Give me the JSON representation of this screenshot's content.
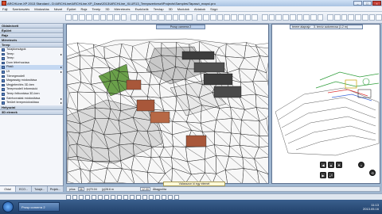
{
  "window": {
    "title": "ARCHLine.XP 2013 Standard - D:\\ARCHLine\\ARCHLine.XP_Draw\\2013\\ARCHLine_XLUR13_Terepszerkeszt\\Projects\\Samples\\Tapasz\\_maps\\.pro"
  },
  "menu": [
    "Fájl",
    "Szerkesztés",
    "Módosítás",
    "Nézet",
    "Épület",
    "Rajz",
    "Tereip",
    "3D",
    "Mérretezés",
    "Eszközök",
    "Tervlap",
    "3D",
    "Modulok",
    "Ablakok",
    "Súgó"
  ],
  "left_panel": {
    "sections": [
      {
        "label": "Oldalnézeti",
        "items": []
      },
      {
        "label": "Épület",
        "items": []
      },
      {
        "label": "Rajz",
        "items": []
      },
      {
        "label": "Méretezés",
        "items": []
      },
      {
        "label": "Terep",
        "items": [
          {
            "label": "Tulajdonságok",
            "arrow": false,
            "selected": false
          },
          {
            "label": "Terep",
            "arrow": true,
            "selected": false
          },
          {
            "label": "Terep",
            "arrow": false,
            "selected": false
          },
          {
            "label": "Dom létrehozása",
            "arrow": false,
            "selected": false
          },
          {
            "label": "Platö",
            "arrow": true,
            "selected": true
          },
          {
            "label": "Út",
            "arrow": true,
            "selected": false
          },
          {
            "label": "Tömegmodell",
            "arrow": false,
            "selected": false
          },
          {
            "label": "Magasság módosítása",
            "arrow": false,
            "selected": false
          },
          {
            "label": "Megjelenítés 3D-ben",
            "arrow": false,
            "selected": false
          },
          {
            "label": "Terepmodell információ",
            "arrow": false,
            "selected": false
          },
          {
            "label": "Terep felbontása 3D-ben",
            "arrow": false,
            "selected": false
          },
          {
            "label": "Szintvonalak módosítása",
            "arrow": true,
            "selected": false
          },
          {
            "label": "Terület terepmódosítása",
            "arrow": true,
            "selected": false
          }
        ]
      },
      {
        "label": "Helyszíni",
        "items": []
      },
      {
        "label": "3D elemek",
        "items": []
      }
    ],
    "tabs": [
      {
        "label": "Oldal",
        "active": true
      },
      {
        "label": "ECO...",
        "active": false
      },
      {
        "label": "Tulajd...",
        "active": false
      },
      {
        "label": "Projek...",
        "active": false
      }
    ]
  },
  "viewports": {
    "left_caption": "Prosp camerra 2",
    "right_caption": [
      "terere alaprajz",
      "3. tervíz autorrecsa (1.2 m)"
    ]
  },
  "nav_widget": {
    "buttons": [
      "◀",
      "▲",
      "▼",
      "▶",
      "⤢",
      "⌂",
      "⟲"
    ]
  },
  "status": {
    "hint": "Válasszon ki egy elemet",
    "field1_label": "pílus",
    "field1_value": "08",
    "field2_value": "(x)70.04",
    "field3_value": "(y)28.6 m",
    "field4_value": "12.00",
    "field5_label": "Átlagpolíta"
  },
  "taskbar": {
    "app_label": "Prosp comerra 2",
    "time": "11:13",
    "date": "2013.05.16"
  },
  "colors": {
    "accent": "#3a6298",
    "viewport_bg": "#ffffff",
    "mesh": "#1a1a1a",
    "roof": "#a8573a",
    "grass": "#6aa04a"
  }
}
